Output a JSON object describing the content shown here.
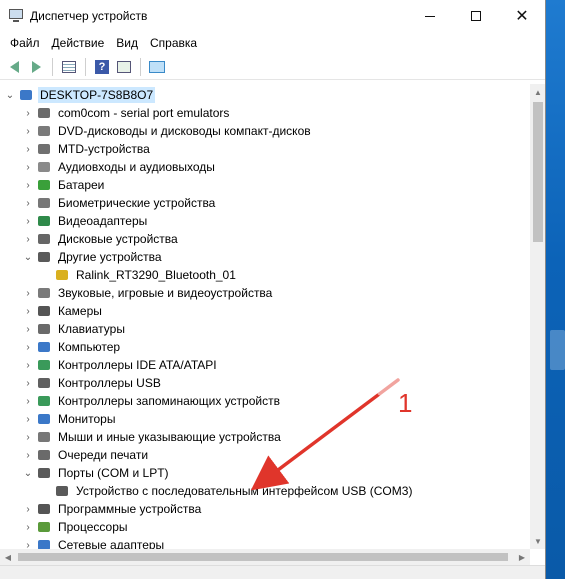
{
  "window": {
    "title": "Диспетчер устройств",
    "controls": {
      "minimize": "—",
      "maximize": "□",
      "close": "✕"
    }
  },
  "menu": [
    "Файл",
    "Действие",
    "Вид",
    "Справка"
  ],
  "toolbar": {
    "icons": [
      "back-icon",
      "forward-icon",
      "properties-icon",
      "help-icon",
      "update-driver-icon",
      "scan-hardware-icon"
    ]
  },
  "tree": {
    "root": {
      "label": "DESKTOP-7S8B8O7",
      "expanded": true,
      "chevron": "⌄"
    },
    "items": [
      {
        "label": "com0com - serial port emulators",
        "chevron": "›",
        "color": "#6b6b6b"
      },
      {
        "label": "DVD-дисководы и дисководы компакт-дисков",
        "chevron": "›",
        "color": "#7a7a7a"
      },
      {
        "label": "MTD-устройства",
        "chevron": "›",
        "color": "#707070"
      },
      {
        "label": "Аудиовходы и аудиовыходы",
        "chevron": "›",
        "color": "#8a8a8a"
      },
      {
        "label": "Батареи",
        "chevron": "›",
        "color": "#3aa03a"
      },
      {
        "label": "Биометрические устройства",
        "chevron": "›",
        "color": "#777777"
      },
      {
        "label": "Видеоадаптеры",
        "chevron": "›",
        "color": "#2f8a4a"
      },
      {
        "label": "Дисковые устройства",
        "chevron": "›",
        "color": "#666666"
      },
      {
        "label": "Другие устройства",
        "chevron": "⌄",
        "color": "#5a5a5a"
      },
      {
        "label": "Ralink_RT3290_Bluetooth_01",
        "chevron": "",
        "color": "#d9b020",
        "child": true
      },
      {
        "label": "Звуковые, игровые и видеоустройства",
        "chevron": "›",
        "color": "#7a7a7a"
      },
      {
        "label": "Камеры",
        "chevron": "›",
        "color": "#555555"
      },
      {
        "label": "Клавиатуры",
        "chevron": "›",
        "color": "#6a6a6a"
      },
      {
        "label": "Компьютер",
        "chevron": "›",
        "color": "#3b78c8"
      },
      {
        "label": "Контроллеры IDE ATA/ATAPI",
        "chevron": "›",
        "color": "#3a9a5a"
      },
      {
        "label": "Контроллеры USB",
        "chevron": "›",
        "color": "#606060"
      },
      {
        "label": "Контроллеры запоминающих устройств",
        "chevron": "›",
        "color": "#3a9a5a"
      },
      {
        "label": "Мониторы",
        "chevron": "›",
        "color": "#3b78c8"
      },
      {
        "label": "Мыши и иные указывающие устройства",
        "chevron": "›",
        "color": "#777777"
      },
      {
        "label": "Очереди печати",
        "chevron": "›",
        "color": "#6a6a6a"
      },
      {
        "label": "Порты (COM и LPT)",
        "chevron": "⌄",
        "color": "#5a5a5a"
      },
      {
        "label": "Устройство с последовательным интерфейсом USB (COM3)",
        "chevron": "",
        "color": "#5a5a5a",
        "child": true
      },
      {
        "label": "Программные устройства",
        "chevron": "›",
        "color": "#555555"
      },
      {
        "label": "Процессоры",
        "chevron": "›",
        "color": "#5a9a3a"
      },
      {
        "label": "Сетевые адаптеры",
        "chevron": "›",
        "color": "#3b78c8"
      }
    ]
  },
  "annotation": {
    "number": "1",
    "color": "#e0352b"
  }
}
